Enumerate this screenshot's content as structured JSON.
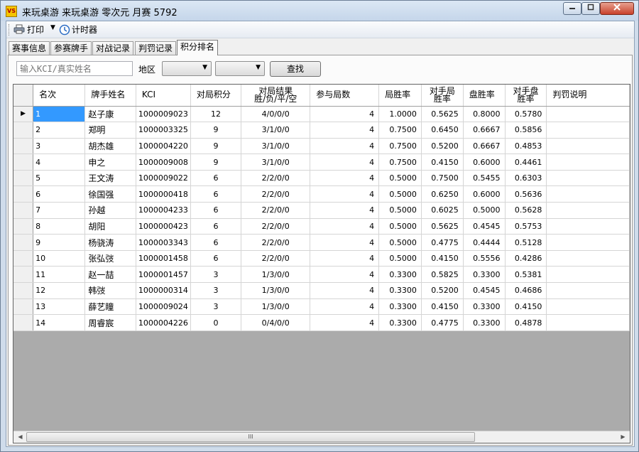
{
  "window": {
    "title": "来玩桌游 来玩桌游 零次元 月赛 5792",
    "app_icon_text": "VS",
    "minimize_icon": "minimize-icon",
    "maximize_icon": "maximize-icon",
    "close_icon": "close-icon"
  },
  "toolbar": {
    "print_label": "打印",
    "timer_label": "计时器"
  },
  "tabs": [
    {
      "label": "赛事信息"
    },
    {
      "label": "参赛牌手"
    },
    {
      "label": "对战记录"
    },
    {
      "label": "判罚记录"
    },
    {
      "label": "积分排名"
    }
  ],
  "filter": {
    "search_placeholder": "输入KCI/真实姓名",
    "region_label": "地区",
    "find_label": "查找"
  },
  "grid": {
    "columns": [
      "名次",
      "牌手姓名",
      "KCI",
      "对局积分",
      "对局结果\n胜/负/平/空",
      "参与局数",
      "局胜率",
      "对手局\n胜率",
      "盘胜率",
      "对手盘\n胜率",
      "判罚说明"
    ],
    "rows": [
      {
        "rank": "1",
        "name": "赵子康",
        "kci": "1000009023",
        "points": "12",
        "result": "4/0/0/0",
        "games": "4",
        "gwr": "1.0000",
        "ogwr": "0.5625",
        "mwr": "0.8000",
        "omwr": "0.5780",
        "penalty": ""
      },
      {
        "rank": "2",
        "name": "郑明",
        "kci": "1000003325",
        "points": "9",
        "result": "3/1/0/0",
        "games": "4",
        "gwr": "0.7500",
        "ogwr": "0.6450",
        "mwr": "0.6667",
        "omwr": "0.5856",
        "penalty": ""
      },
      {
        "rank": "3",
        "name": "胡杰雄",
        "kci": "1000004220",
        "points": "9",
        "result": "3/1/0/0",
        "games": "4",
        "gwr": "0.7500",
        "ogwr": "0.5200",
        "mwr": "0.6667",
        "omwr": "0.4853",
        "penalty": ""
      },
      {
        "rank": "4",
        "name": "申之",
        "kci": "1000009008",
        "points": "9",
        "result": "3/1/0/0",
        "games": "4",
        "gwr": "0.7500",
        "ogwr": "0.4150",
        "mwr": "0.6000",
        "omwr": "0.4461",
        "penalty": ""
      },
      {
        "rank": "5",
        "name": "王文涛",
        "kci": "1000009022",
        "points": "6",
        "result": "2/2/0/0",
        "games": "4",
        "gwr": "0.5000",
        "ogwr": "0.7500",
        "mwr": "0.5455",
        "omwr": "0.6303",
        "penalty": ""
      },
      {
        "rank": "6",
        "name": "徐国强",
        "kci": "1000000418",
        "points": "6",
        "result": "2/2/0/0",
        "games": "4",
        "gwr": "0.5000",
        "ogwr": "0.6250",
        "mwr": "0.6000",
        "omwr": "0.5636",
        "penalty": ""
      },
      {
        "rank": "7",
        "name": "孙越",
        "kci": "1000004233",
        "points": "6",
        "result": "2/2/0/0",
        "games": "4",
        "gwr": "0.5000",
        "ogwr": "0.6025",
        "mwr": "0.5000",
        "omwr": "0.5628",
        "penalty": ""
      },
      {
        "rank": "8",
        "name": "胡阳",
        "kci": "1000000423",
        "points": "6",
        "result": "2/2/0/0",
        "games": "4",
        "gwr": "0.5000",
        "ogwr": "0.5625",
        "mwr": "0.4545",
        "omwr": "0.5753",
        "penalty": ""
      },
      {
        "rank": "9",
        "name": "杨骁涛",
        "kci": "1000003343",
        "points": "6",
        "result": "2/2/0/0",
        "games": "4",
        "gwr": "0.5000",
        "ogwr": "0.4775",
        "mwr": "0.4444",
        "omwr": "0.5128",
        "penalty": ""
      },
      {
        "rank": "10",
        "name": "张弘弢",
        "kci": "1000001458",
        "points": "6",
        "result": "2/2/0/0",
        "games": "4",
        "gwr": "0.5000",
        "ogwr": "0.4150",
        "mwr": "0.5556",
        "omwr": "0.4286",
        "penalty": ""
      },
      {
        "rank": "11",
        "name": "赵一喆",
        "kci": "1000001457",
        "points": "3",
        "result": "1/3/0/0",
        "games": "4",
        "gwr": "0.3300",
        "ogwr": "0.5825",
        "mwr": "0.3300",
        "omwr": "0.5381",
        "penalty": ""
      },
      {
        "rank": "12",
        "name": "韩弢",
        "kci": "1000000314",
        "points": "3",
        "result": "1/3/0/0",
        "games": "4",
        "gwr": "0.3300",
        "ogwr": "0.5200",
        "mwr": "0.4545",
        "omwr": "0.4686",
        "penalty": ""
      },
      {
        "rank": "13",
        "name": "薛艺瞳",
        "kci": "1000009024",
        "points": "3",
        "result": "1/3/0/0",
        "games": "4",
        "gwr": "0.3300",
        "ogwr": "0.4150",
        "mwr": "0.3300",
        "omwr": "0.4150",
        "penalty": ""
      },
      {
        "rank": "14",
        "name": "周睿宸",
        "kci": "1000004226",
        "points": "0",
        "result": "0/4/0/0",
        "games": "4",
        "gwr": "0.3300",
        "ogwr": "0.4775",
        "mwr": "0.3300",
        "omwr": "0.4878",
        "penalty": ""
      }
    ],
    "current_row_marker": "▶",
    "scroll_thumb_grip": "III"
  }
}
